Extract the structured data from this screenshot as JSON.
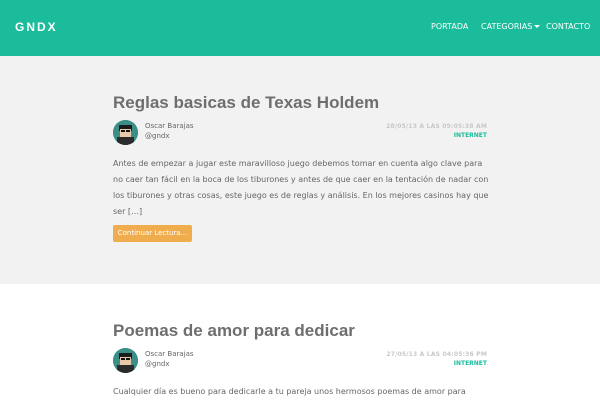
{
  "colors": {
    "accent": "#1abc9c",
    "button": "#f0ad4e",
    "gray_band": "#f2f2f2"
  },
  "navbar": {
    "brand": "GNDX",
    "links": [
      {
        "label": "PORTADA"
      },
      {
        "label": "CATEGORIAS",
        "icon": "caret-down-icon"
      },
      {
        "label": "CONTACTO"
      }
    ]
  },
  "posts": [
    {
      "title": "Reglas basicas de Texas Holdem",
      "author": "Oscar Barajas",
      "handle": "@gndx",
      "date": "28/05/13 A LAS 09:05:38 AM",
      "category": "INTERNET",
      "excerpt": "Antes de empezar a jugar este maravilloso juego debemos tomar en cuenta algo clave para no caer tan fácil en la boca de los tiburones y antes de que caer en la tentación de nadar con los tiburones y otras cosas, este juego es de reglas y análisis. En los mejores casinos hay que ser […]",
      "button": "Continuar Lectura..."
    },
    {
      "title": "Poemas de amor para dedicar",
      "author": "Oscar Barajas",
      "handle": "@gndx",
      "date": "27/05/13 A LAS 04:05:36 PM",
      "category": "INTERNET",
      "excerpt": "Cualquier día es bueno para dedicarle a tu pareja unos hermosos poemas de amor para"
    }
  ]
}
